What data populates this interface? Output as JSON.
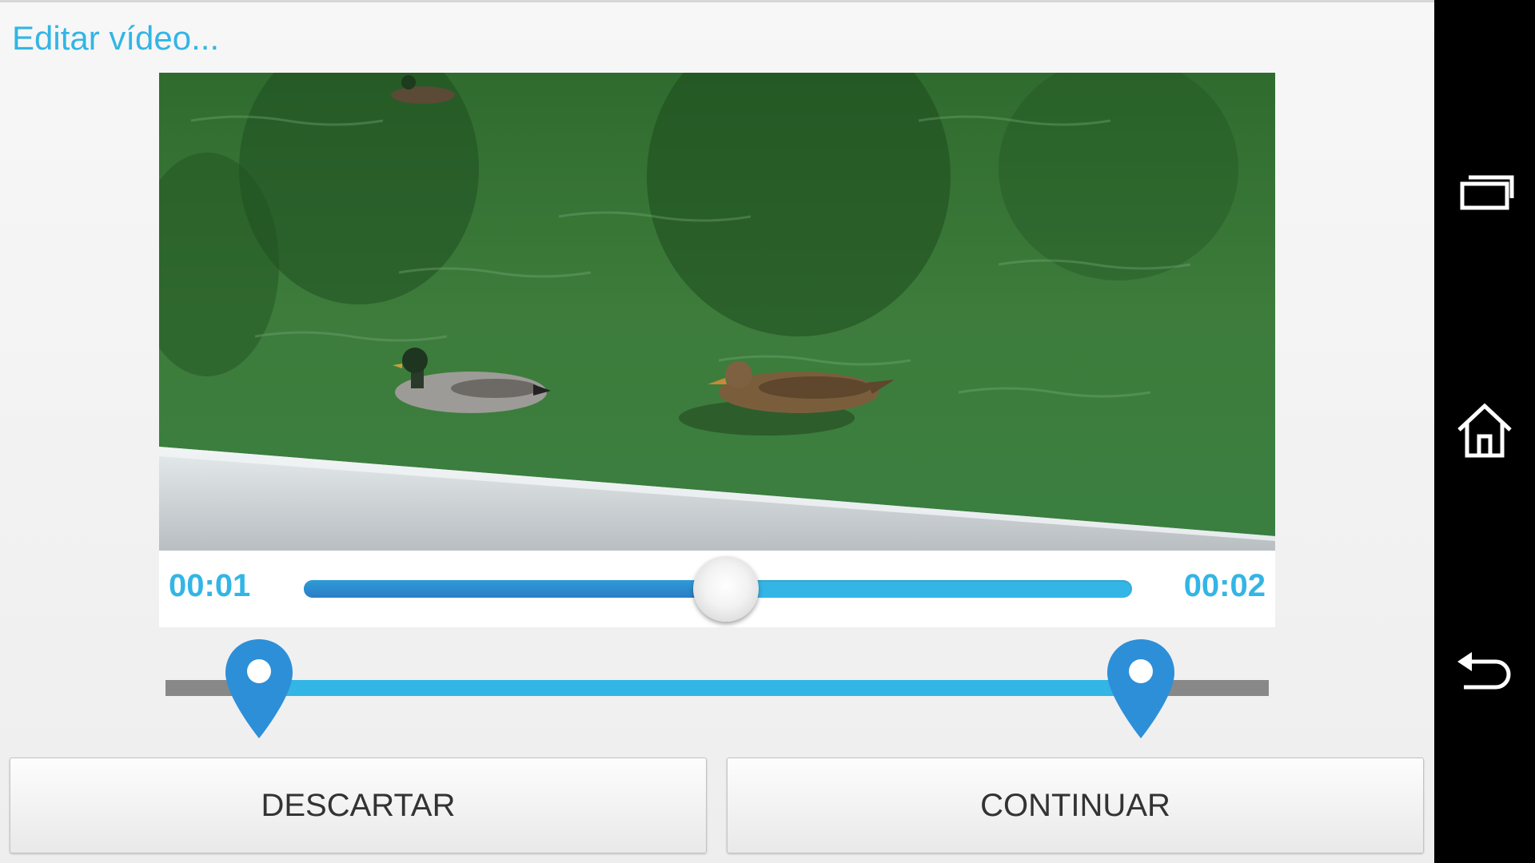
{
  "window": {
    "title": "Editar vídeo..."
  },
  "player": {
    "time_current": "00:01",
    "time_total": "00:02",
    "progress_fraction": 0.51
  },
  "trim": {
    "start_fraction": 0.085,
    "end_fraction": 0.884
  },
  "buttons": {
    "discard_label": "DESCARTAR",
    "continue_label": "CONTINUAR"
  },
  "navbar": {
    "recents_icon": "recent-apps-icon",
    "home_icon": "home-icon",
    "back_icon": "back-icon"
  },
  "colors": {
    "accent": "#33b5e5",
    "accent_dark": "#2a7fc4",
    "track_gray": "#888888",
    "marker": "#2d8fd8"
  }
}
